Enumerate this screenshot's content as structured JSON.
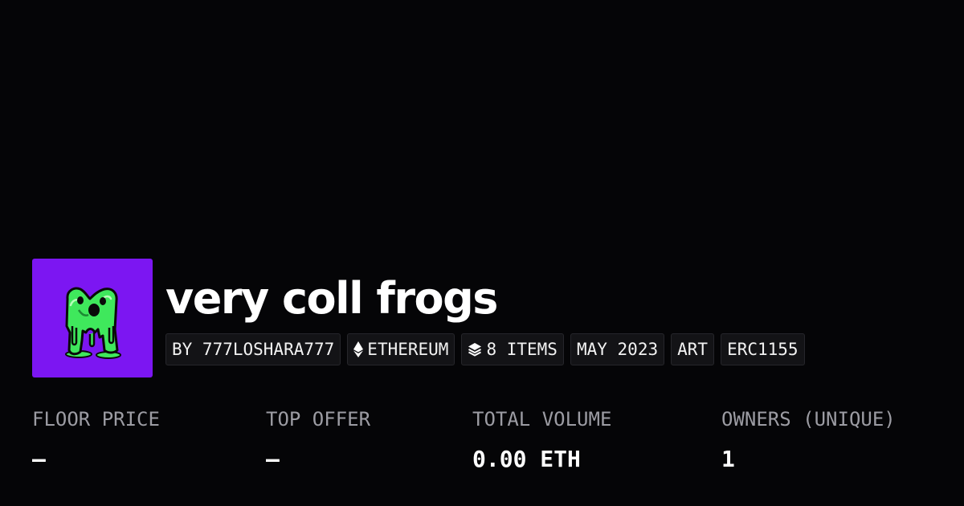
{
  "collection": {
    "title": "very coll frogs",
    "avatar_bg_color": "#7C16F2",
    "avatar_icon": "green-slime-monster-icon",
    "chips": [
      {
        "label": "BY 777LOSHARA777"
      },
      {
        "label": "ETHEREUM",
        "icon": "ethereum-icon"
      },
      {
        "label": "8 ITEMS",
        "icon": "layers-icon"
      },
      {
        "label": "MAY 2023"
      },
      {
        "label": "ART"
      },
      {
        "label": "ERC1155"
      }
    ]
  },
  "stats": [
    {
      "label": "FLOOR PRICE",
      "value": "–"
    },
    {
      "label": "TOP OFFER",
      "value": "–"
    },
    {
      "label": "TOTAL VOLUME",
      "value": "0.00 ETH"
    },
    {
      "label": "OWNERS (UNIQUE)",
      "value": "1"
    }
  ],
  "colors": {
    "background": "#050507",
    "label_gray": "#9C9CA3",
    "slime_green": "#3FE85C"
  }
}
